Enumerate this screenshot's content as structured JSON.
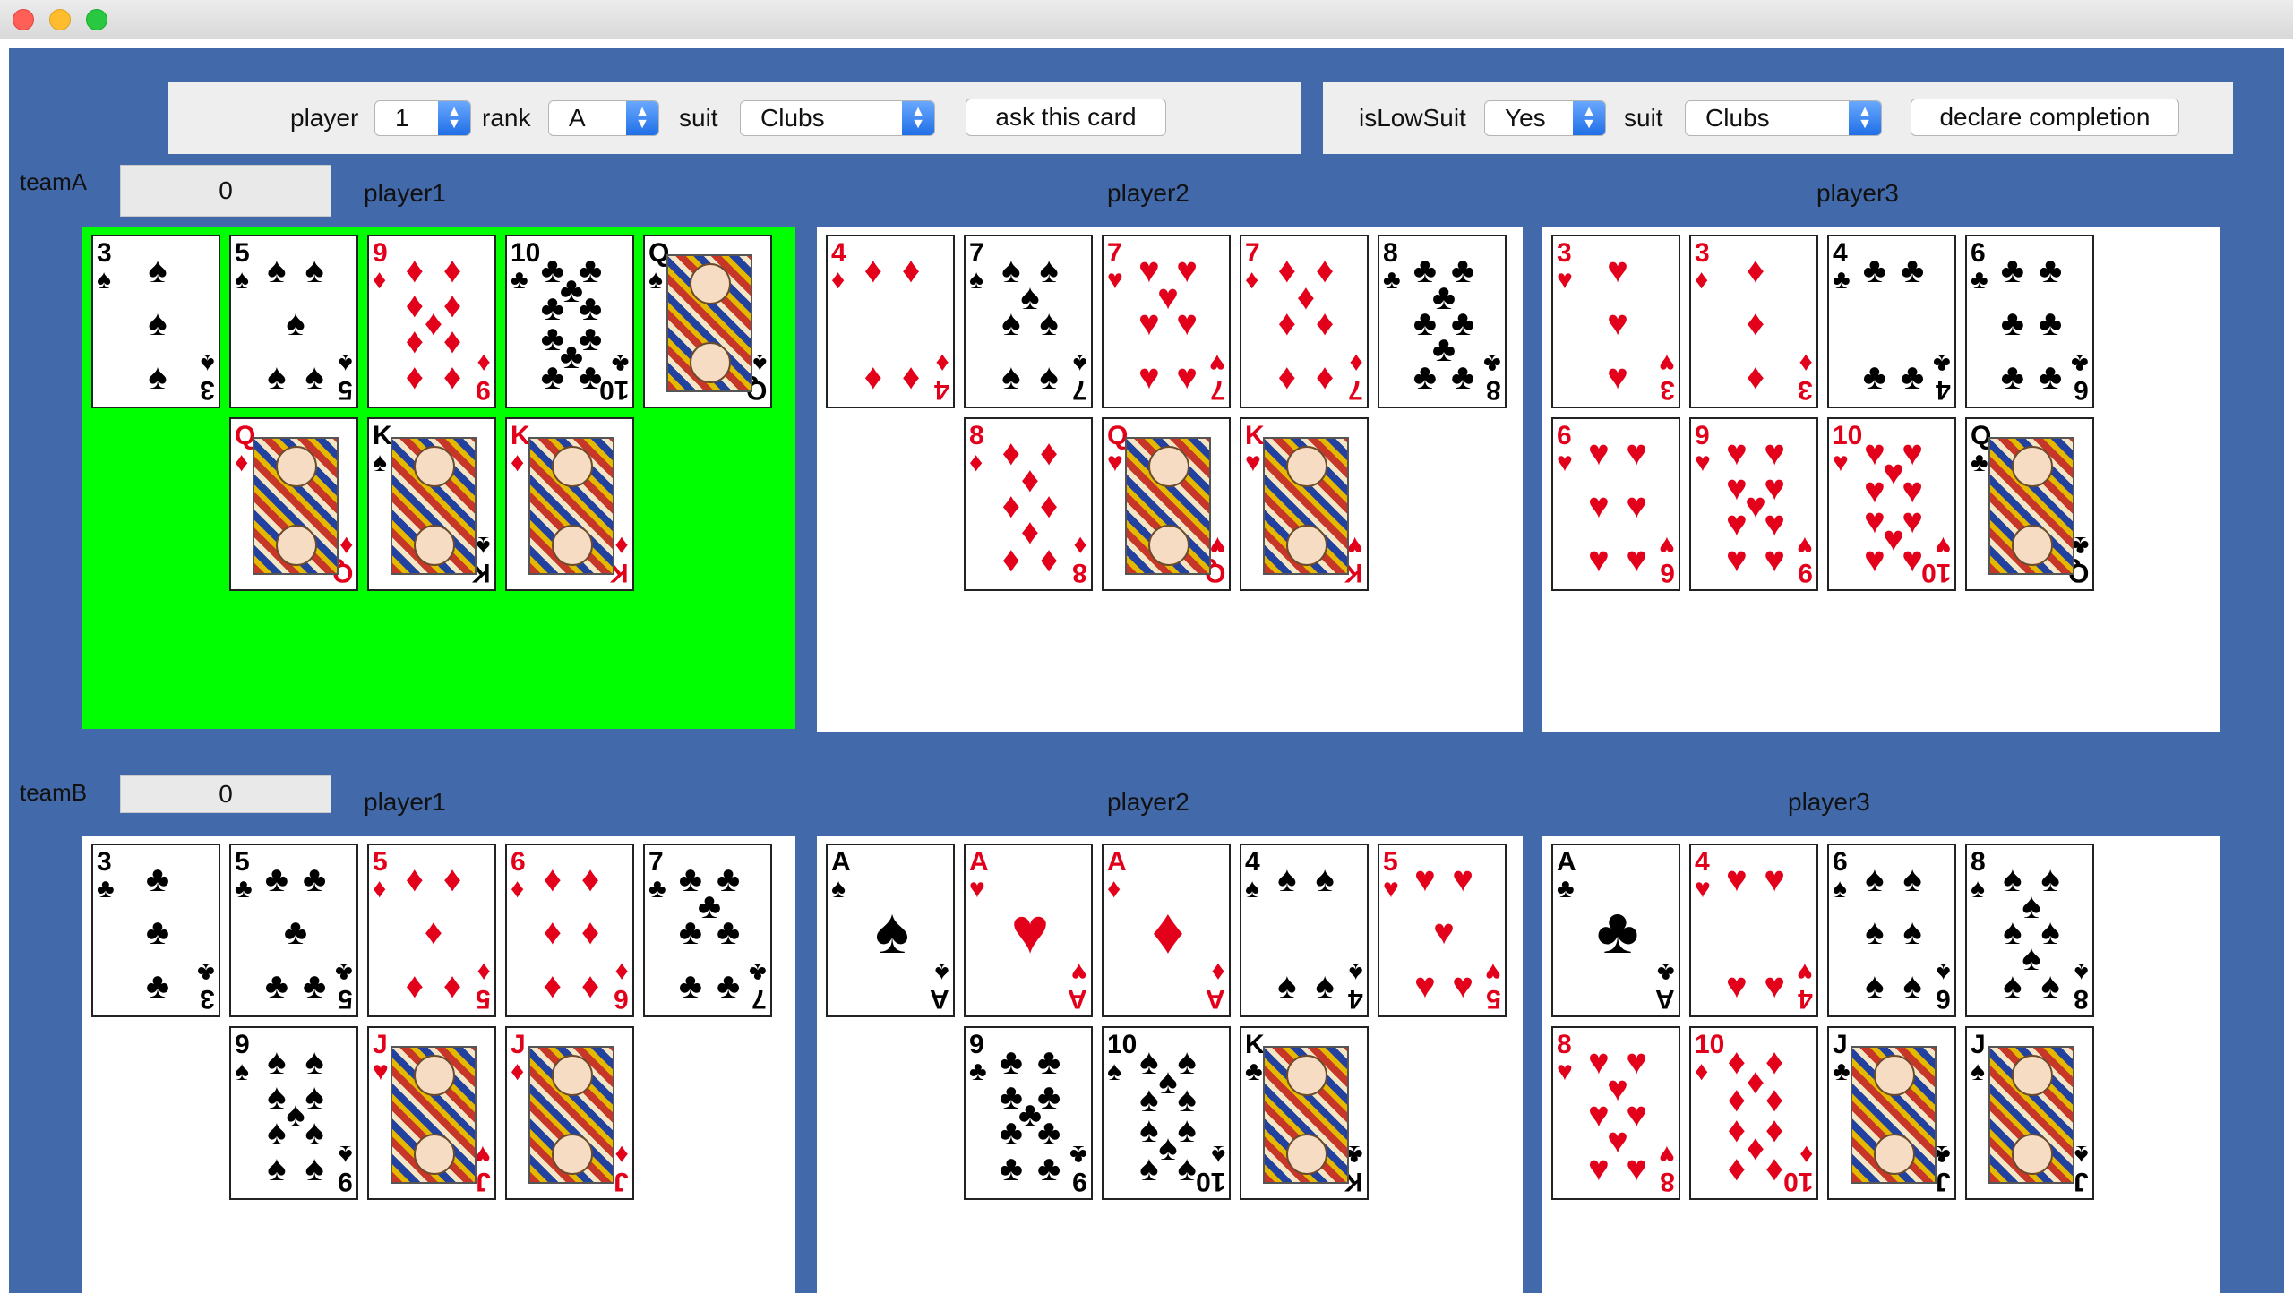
{
  "controls": {
    "ask": {
      "player_label": "player",
      "player_value": "1",
      "rank_label": "rank",
      "rank_value": "A",
      "suit_label": "suit",
      "suit_value": "Clubs",
      "button": "ask this card"
    },
    "declare": {
      "islowsuit_label": "isLowSuit",
      "islowsuit_value": "Yes",
      "suit_label": "suit",
      "suit_value": "Clubs",
      "button": "declare completion"
    }
  },
  "colors": {
    "background": "#4269aa",
    "active_player_panel": "#00ff00",
    "panel": "#ffffff",
    "red_suit": "#e2001a",
    "black_suit": "#000000"
  },
  "teams": [
    {
      "name": "teamA",
      "score": "0",
      "players": [
        {
          "name": "player1",
          "active": true,
          "cards": [
            {
              "r": "3",
              "s": "spade"
            },
            {
              "r": "5",
              "s": "spade"
            },
            {
              "r": "9",
              "s": "diamond"
            },
            {
              "r": "10",
              "s": "club"
            },
            {
              "r": "Q",
              "s": "spade"
            },
            {
              "r": "Q",
              "s": "diamond"
            },
            {
              "r": "K",
              "s": "spade"
            },
            {
              "r": "K",
              "s": "diamond"
            }
          ]
        },
        {
          "name": "player2",
          "active": false,
          "cards": [
            {
              "r": "4",
              "s": "diamond"
            },
            {
              "r": "7",
              "s": "spade"
            },
            {
              "r": "7",
              "s": "heart"
            },
            {
              "r": "7",
              "s": "diamond"
            },
            {
              "r": "8",
              "s": "club"
            },
            {
              "r": "8",
              "s": "diamond"
            },
            {
              "r": "Q",
              "s": "heart"
            },
            {
              "r": "K",
              "s": "heart"
            }
          ]
        },
        {
          "name": "player3",
          "active": false,
          "cards": [
            {
              "r": "3",
              "s": "heart"
            },
            {
              "r": "3",
              "s": "diamond"
            },
            {
              "r": "4",
              "s": "club"
            },
            {
              "r": "6",
              "s": "club"
            },
            {
              "r": "6",
              "s": "heart"
            },
            {
              "r": "9",
              "s": "heart"
            },
            {
              "r": "10",
              "s": "heart"
            },
            {
              "r": "Q",
              "s": "club"
            }
          ]
        }
      ]
    },
    {
      "name": "teamB",
      "score": "0",
      "players": [
        {
          "name": "player1",
          "active": false,
          "cards": [
            {
              "r": "3",
              "s": "club"
            },
            {
              "r": "5",
              "s": "club"
            },
            {
              "r": "5",
              "s": "diamond"
            },
            {
              "r": "6",
              "s": "diamond"
            },
            {
              "r": "7",
              "s": "club"
            },
            {
              "r": "9",
              "s": "spade"
            },
            {
              "r": "J",
              "s": "heart"
            },
            {
              "r": "J",
              "s": "diamond"
            }
          ]
        },
        {
          "name": "player2",
          "active": false,
          "cards": [
            {
              "r": "A",
              "s": "spade"
            },
            {
              "r": "A",
              "s": "heart"
            },
            {
              "r": "A",
              "s": "diamond"
            },
            {
              "r": "4",
              "s": "spade"
            },
            {
              "r": "5",
              "s": "heart"
            },
            {
              "r": "9",
              "s": "club"
            },
            {
              "r": "10",
              "s": "spade"
            },
            {
              "r": "K",
              "s": "club"
            }
          ]
        },
        {
          "name": "player3",
          "active": false,
          "cards": [
            {
              "r": "A",
              "s": "club"
            },
            {
              "r": "4",
              "s": "heart"
            },
            {
              "r": "6",
              "s": "spade"
            },
            {
              "r": "8",
              "s": "spade"
            },
            {
              "r": "8",
              "s": "heart"
            },
            {
              "r": "10",
              "s": "diamond"
            },
            {
              "r": "J",
              "s": "club"
            },
            {
              "r": "J",
              "s": "spade"
            }
          ]
        }
      ]
    }
  ]
}
